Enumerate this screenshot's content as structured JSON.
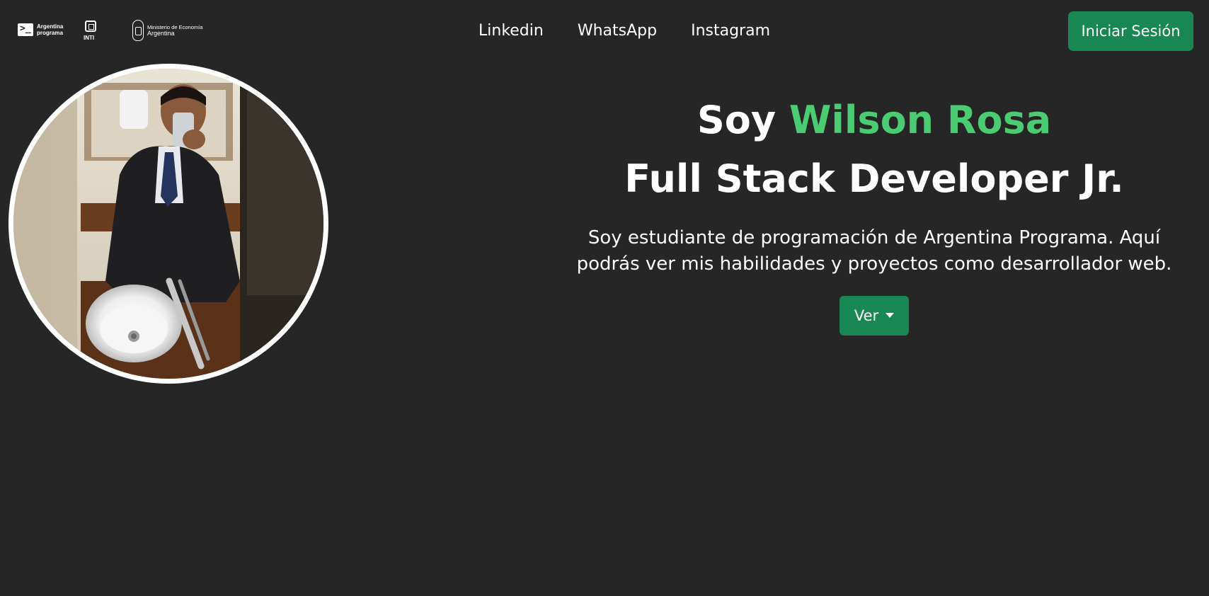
{
  "header": {
    "logos": {
      "argentina_programa": {
        "icon": "terminal-prompt-icon",
        "line1": "Argentina",
        "line2": "programa"
      },
      "inti": {
        "icon": "inti-square-icon",
        "label": "INTI"
      },
      "ministerio": {
        "icon": "argentina-seal-icon",
        "line1": "Ministerio de Economía",
        "line2": "Argentina"
      }
    },
    "nav": [
      {
        "label": "Linkedin"
      },
      {
        "label": "WhatsApp"
      },
      {
        "label": "Instagram"
      }
    ],
    "login_label": "Iniciar Sesión"
  },
  "hero": {
    "greeting_prefix": "Soy",
    "name": "Wilson Rosa",
    "role": "Full Stack Developer Jr.",
    "description": "Soy estudiante de programación de Argentina Programa. Aquí podrás ver mis habilidades y proyectos como desarrollador web.",
    "ver_label": "Ver",
    "ver_icon": "caret-down-icon"
  },
  "colors": {
    "background": "#262626",
    "accent_green": "#4bcb72",
    "button_green": "#198754",
    "text": "#ffffff"
  }
}
